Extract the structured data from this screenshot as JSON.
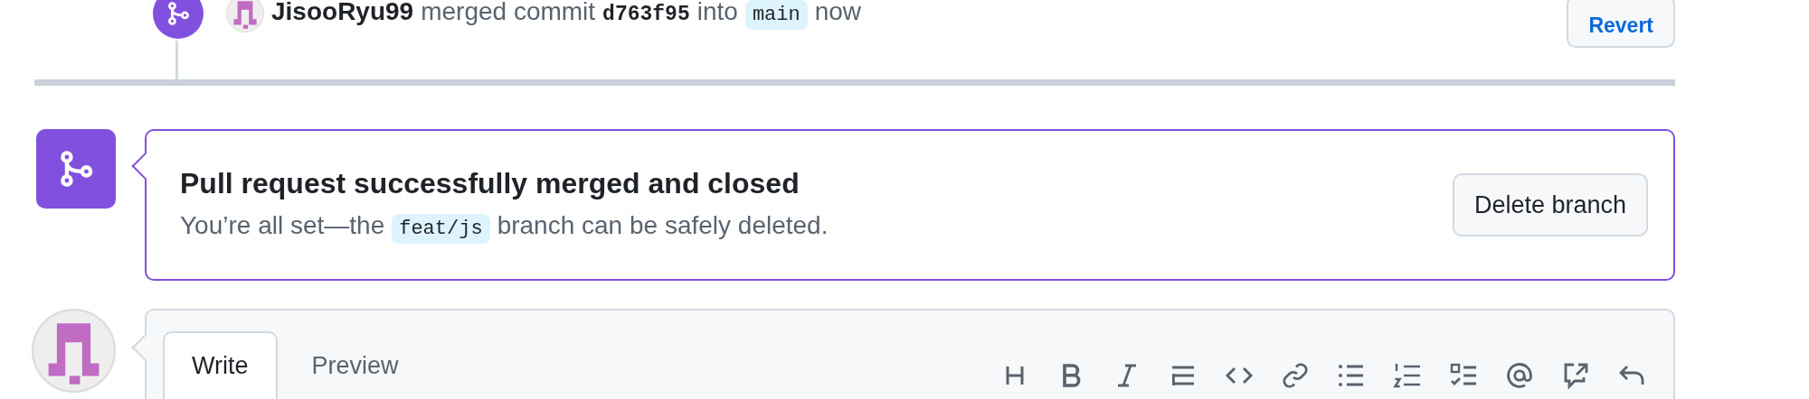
{
  "merge_event": {
    "user": "JisooRyu99",
    "action": "merged commit",
    "commit": "d763f95",
    "connector": "into",
    "branch": "main",
    "time": "now",
    "revert_button": "Revert"
  },
  "merged_notice": {
    "title": "Pull request successfully merged and closed",
    "message_before": "You’re all set—the",
    "branch": "feat/js",
    "message_after": "branch can be safely deleted.",
    "button": "Delete branch"
  },
  "comment_box": {
    "tabs": [
      {
        "label": "Write",
        "selected": true
      },
      {
        "label": "Preview",
        "selected": false
      }
    ]
  }
}
